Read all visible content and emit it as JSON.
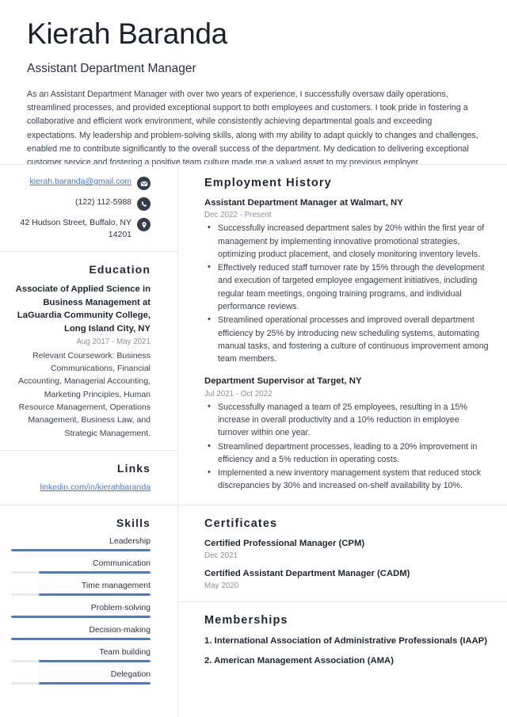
{
  "header": {
    "name": "Kierah Baranda",
    "job_title": "Assistant Department Manager",
    "summary": "As an Assistant Department Manager with over two years of experience, I successfully oversaw daily operations, streamlined processes, and provided exceptional support to both employees and customers. I took pride in fostering a collaborative and efficient work environment, while consistently achieving departmental goals and exceeding expectations. My leadership and problem-solving skills, along with my ability to adapt quickly to changes and challenges, enabled me to contribute significantly to the overall success of the department. My dedication to delivering exceptional customer service and fostering a positive team culture made me a valued asset to my previous employer."
  },
  "contact": {
    "email": "kierah.baranda@gmail.com",
    "email_icon": "envelope-icon",
    "phone": "(122) 112-5988",
    "phone_icon": "phone-icon",
    "address": "42 Hudson Street, Buffalo, NY 14201",
    "address_icon": "location-pin-icon"
  },
  "education": {
    "heading": "Education",
    "degree": "Associate of Applied Science in Business Management at LaGuardia Community College, Long Island City, NY",
    "date": "Aug 2017 - May 2021",
    "description": "Relevant Coursework: Business Communications, Financial Accounting, Managerial Accounting, Marketing Principles, Human Resource Management, Operations Management, Business Law, and Strategic Management."
  },
  "links": {
    "heading": "Links",
    "items": [
      {
        "label": "linkedin.com/in/kierahbaranda"
      }
    ]
  },
  "skills": {
    "heading": "Skills",
    "items": [
      {
        "name": "Leadership",
        "level": 100
      },
      {
        "name": "Communication",
        "level": 80
      },
      {
        "name": "Time management",
        "level": 80
      },
      {
        "name": "Problem-solving",
        "level": 100
      },
      {
        "name": "Decision-making",
        "level": 100
      },
      {
        "name": "Team building",
        "level": 80
      },
      {
        "name": "Delegation",
        "level": 80
      }
    ]
  },
  "employment": {
    "heading": "Employment History",
    "jobs": [
      {
        "title": "Assistant Department Manager at Walmart, NY",
        "date": "Dec 2022 - Present",
        "bullets": [
          "Successfully increased department sales by 20% within the first year of management by implementing innovative promotional strategies, optimizing product placement, and closely monitoring inventory levels.",
          "Effectively reduced staff turnover rate by 15% through the development and execution of targeted employee engagement initiatives, including regular team meetings, ongoing training programs, and individual performance reviews.",
          "Streamlined operational processes and improved overall department efficiency by 25% by introducing new scheduling systems, automating manual tasks, and fostering a culture of continuous improvement among team members."
        ]
      },
      {
        "title": "Department Supervisor at Target, NY",
        "date": "Jul 2021 - Oct 2022",
        "bullets": [
          "Successfully managed a team of 25 employees, resulting in a 15% increase in overall productivity and a 10% reduction in employee turnover within one year.",
          "Streamlined department processes, leading to a 20% improvement in efficiency and a 5% reduction in operating costs.",
          "Implemented a new inventory management system that reduced stock discrepancies by 30% and increased on-shelf availability by 10%."
        ]
      }
    ]
  },
  "certificates": {
    "heading": "Certificates",
    "items": [
      {
        "name": "Certified Professional Manager (CPM)",
        "date": "Dec 2021"
      },
      {
        "name": "Certified Assistant Department Manager (CADM)",
        "date": "May 2020"
      }
    ]
  },
  "memberships": {
    "heading": "Memberships",
    "items": [
      {
        "label": "1. International Association of Administrative Professionals (IAAP)"
      },
      {
        "label": "2. American Management Association (AMA)"
      }
    ]
  },
  "colors": {
    "accent": "#3b7af0",
    "icon_circle": "#333d4f",
    "heading": "#1e2633",
    "muted": "#8b909b",
    "divider": "#e6e8ec"
  }
}
